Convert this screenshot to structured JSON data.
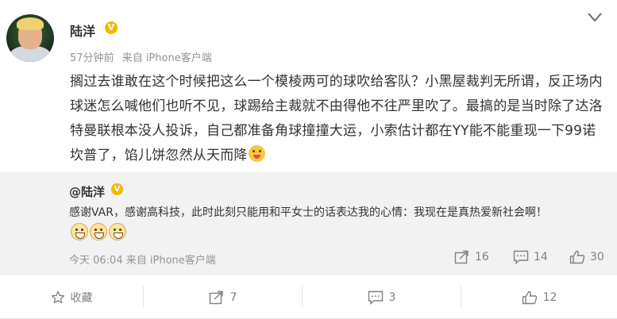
{
  "post": {
    "author": "陆洋",
    "verified_mark": "V",
    "time": "57分钟前",
    "source": "来自 iPhone客户端",
    "text": "搁过去谁敢在这个时候把这么一个模棱两可的球吹给客队？小黑屋裁判无所谓，反正场内球迷怎么喊他们也听不见，球踢给主裁就不由得他不往严里吹了。最搞的是当时除了达洛特曼联根本没人投诉，自己都准备角球撞撞大运，小索估计都在YY能不能重现一下99诺坎普了，馅儿饼忽然从天而降"
  },
  "repost": {
    "author": "@陆洋",
    "verified_mark": "V",
    "text": "感谢VAR，感谢高科技，此时此刻只能用和平女士的话表达我的心情：我现在是真热爱新社会啊！",
    "time": "今天 06:04",
    "source": "来自 iPhone客户端",
    "forward_count": "16",
    "comment_count": "14",
    "like_count": "30"
  },
  "footer": {
    "favorite_label": "收藏",
    "forward_count": "7",
    "comment_count": "3",
    "like_count": "12"
  },
  "icons": [
    "more-icon",
    "verified-icon",
    "emoji-tongue-icon",
    "smile-icon",
    "forward-icon",
    "comment-icon",
    "like-icon",
    "star-icon"
  ],
  "colors": {
    "verified": "#f7b500",
    "meta_text": "#939393",
    "repost_bg": "#f2f2f2"
  }
}
